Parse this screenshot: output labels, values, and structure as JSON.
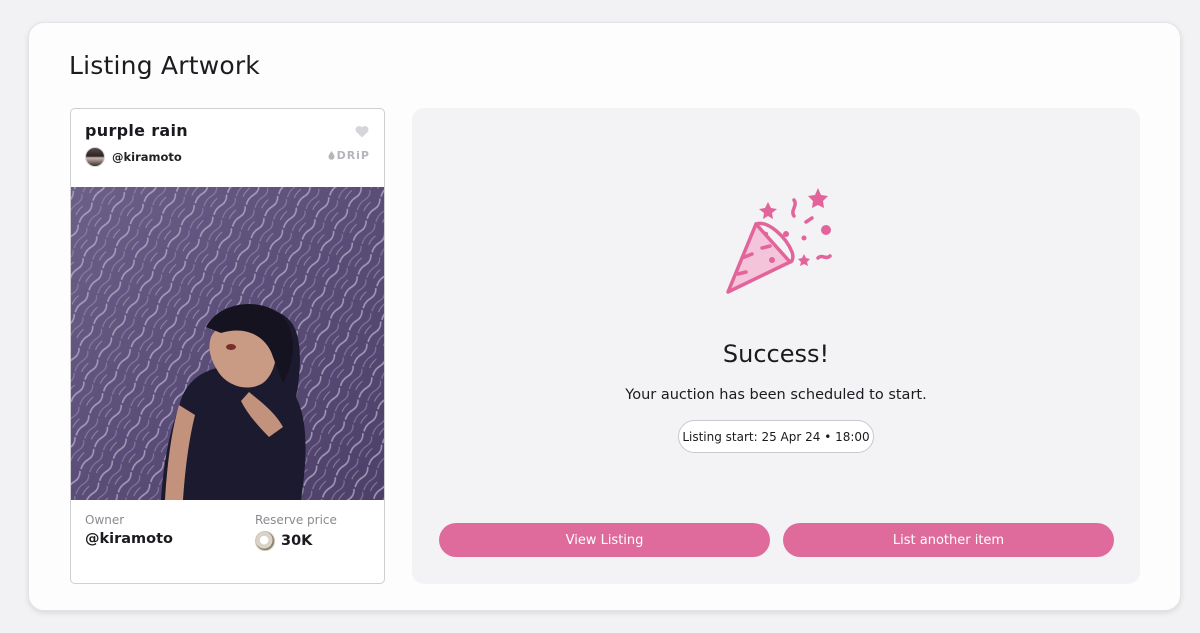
{
  "page": {
    "title": "Listing Artwork"
  },
  "card": {
    "title": "purple rain",
    "creator_handle": "@kiramoto",
    "brand": "DRiP",
    "owner_label": "Owner",
    "owner_value": "@kiramoto",
    "reserve_label": "Reserve price",
    "reserve_value": "30K"
  },
  "success": {
    "title": "Success!",
    "message": "Your auction has been scheduled to start.",
    "listing_start": "Listing start: 25 Apr 24 • 18:00",
    "view_button": "View Listing",
    "list_another_button": "List another item"
  },
  "colors": {
    "accent": "#de6b9c",
    "confetti": "#e2649b",
    "background": "#f2f2f4"
  },
  "icons": {
    "heart": "heart-icon",
    "brand": "drip-logo",
    "celebration": "party-popper-icon",
    "coin": "token-icon"
  }
}
